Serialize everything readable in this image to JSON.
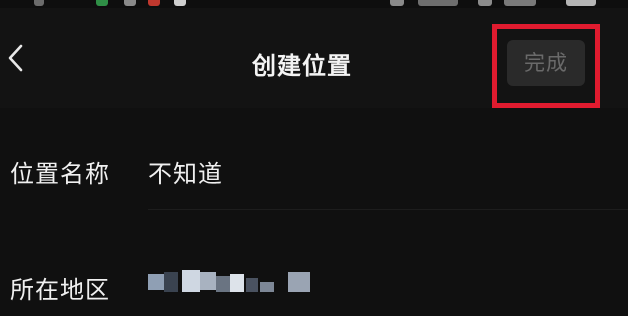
{
  "header": {
    "title": "创建位置",
    "done_label": "完成"
  },
  "form": {
    "name_label": "位置名称",
    "name_value": "不知道",
    "region_label": "所在地区"
  },
  "colors": {
    "background": "#0e0e0e",
    "highlight_box": "#e01b2f",
    "done_text_disabled": "#6a6a6a"
  }
}
